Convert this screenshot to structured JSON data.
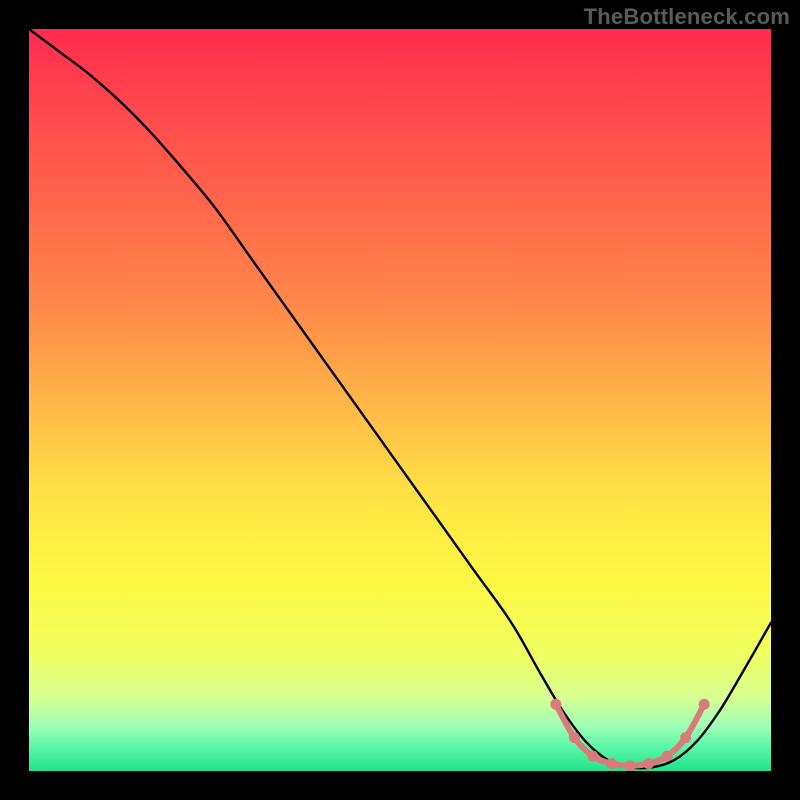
{
  "watermark": "TheBottleneck.com",
  "chart_data": {
    "type": "line",
    "title": "",
    "xlabel": "",
    "ylabel": "",
    "xlim": [
      0,
      100
    ],
    "ylim": [
      0,
      100
    ],
    "grid": false,
    "legend": false,
    "background_gradient": {
      "stops": [
        {
          "offset": 0.0,
          "color": "#ff2b4f"
        },
        {
          "offset": 0.12,
          "color": "#ff4b4d"
        },
        {
          "offset": 0.25,
          "color": "#ff6a4b"
        },
        {
          "offset": 0.38,
          "color": "#ff8a49"
        },
        {
          "offset": 0.5,
          "color": "#ffb547"
        },
        {
          "offset": 0.62,
          "color": "#ffe045"
        },
        {
          "offset": 0.74,
          "color": "#fff843"
        },
        {
          "offset": 0.84,
          "color": "#f2ff5f"
        },
        {
          "offset": 0.9,
          "color": "#d7ff90"
        },
        {
          "offset": 0.94,
          "color": "#9dffb8"
        },
        {
          "offset": 0.97,
          "color": "#55f7a5"
        },
        {
          "offset": 1.0,
          "color": "#22e28b"
        }
      ]
    },
    "series": [
      {
        "name": "bottleneck-curve",
        "color": "#000000",
        "x": [
          0,
          4,
          8,
          12,
          16,
          20,
          25,
          30,
          35,
          40,
          45,
          50,
          55,
          60,
          65,
          69,
          72,
          75,
          78,
          81,
          84,
          87,
          90,
          93,
          96,
          100
        ],
        "values": [
          100,
          97,
          94,
          90.5,
          86.5,
          82,
          76,
          69,
          62,
          55,
          48,
          41,
          34,
          27,
          20,
          13,
          8,
          4,
          1.5,
          0.5,
          0.5,
          1.5,
          4,
          8,
          13,
          20
        ]
      }
    ],
    "highlight": {
      "name": "optimal-zone",
      "color": "#d97b7b",
      "points_x": [
        71,
        73.5,
        76,
        78.5,
        81,
        83.5,
        86,
        88.5,
        91
      ],
      "points_y": [
        9,
        4.5,
        2,
        1,
        0.7,
        1,
        2,
        4.5,
        9
      ]
    }
  }
}
